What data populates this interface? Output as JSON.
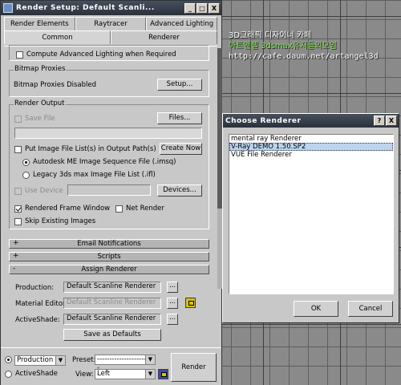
{
  "window": {
    "title": "Render Setup: Default Scanli...",
    "btn_min": "_",
    "btn_max": "□",
    "btn_close": "X"
  },
  "tabs": {
    "row1": [
      "Render Elements",
      "Raytracer",
      "Advanced Lighting"
    ],
    "row2": [
      "Common",
      "Renderer"
    ]
  },
  "common": {
    "compute_adv_lighting": "Compute Advanced Lighting when Required",
    "bitmap_proxies": {
      "title": "Bitmap Proxies",
      "status": "Bitmap Proxies Disabled",
      "setup": "Setup..."
    },
    "render_output": {
      "title": "Render Output",
      "save_file": "Save File",
      "files": "Files...",
      "put_image": "Put Image File List(s) in Output Path(s)",
      "create_now": "Create Now",
      "autodesk": "Autodesk ME Image Sequence File (.imsq)",
      "legacy": "Legacy 3ds max Image File List (.ifl)",
      "use_device": "Use Device",
      "devices": "Devices...",
      "rendered_frame": "Rendered Frame Window",
      "net_render": "Net Render",
      "skip_existing": "Skip Existing Images"
    },
    "rollouts": {
      "email": {
        "sign": "+",
        "title": "Email Notifications"
      },
      "scripts": {
        "sign": "+",
        "title": "Scripts"
      },
      "assign": {
        "sign": "-",
        "title": "Assign Renderer"
      }
    },
    "assign": {
      "production_label": "Production:",
      "production_value": "Default Scanline Renderer",
      "material_label": "Material Editor:",
      "material_value": "Default Scanline Renderer",
      "activeshade_label": "ActiveShade:",
      "activeshade_value": "Default Scanline Renderer",
      "more": "...",
      "save_defaults": "Save as Defaults"
    }
  },
  "bottom": {
    "production": "Production",
    "activeshade": "ActiveShade",
    "preset_label": "Preset:",
    "preset_value": "------------------------",
    "view_label": "View:",
    "view_value": "Left",
    "render": "Render"
  },
  "dialog": {
    "title": "Choose Renderer",
    "help": "?",
    "close": "X",
    "items": [
      "mental ray Renderer",
      "V-Ray DEMO 1.50.SP2",
      "VUE File Renderer"
    ],
    "selected_index": 1,
    "ok": "OK",
    "cancel": "Cancel"
  },
  "watermark": {
    "line1": "3D그래픽 디자이너 카페",
    "line2": "아트앤젤 3dsmax유저들의모임",
    "line3": "http://cafe.daum.net/artangel3d"
  }
}
